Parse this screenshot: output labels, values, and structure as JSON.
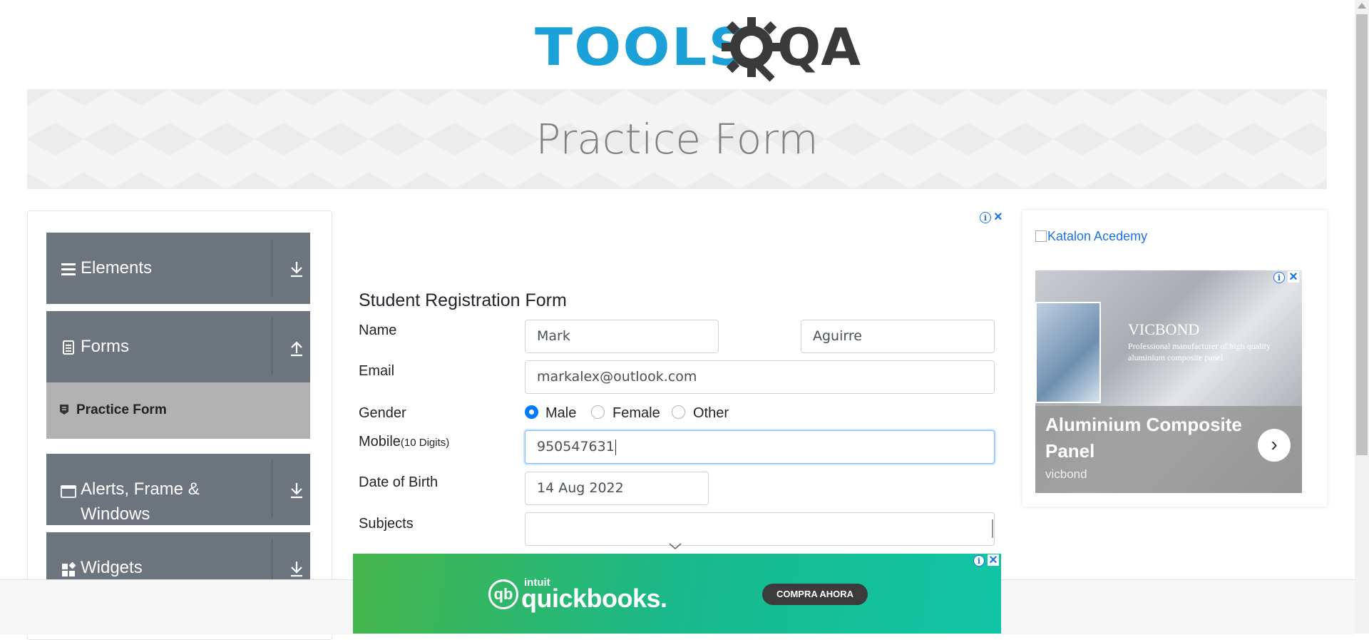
{
  "header": {
    "logo_text_left": "TOOLS",
    "logo_text_right": "QA"
  },
  "banner": {
    "title": "Practice Form"
  },
  "sidebar": {
    "groups": [
      {
        "label": "Elements",
        "icon": "hamburger-icon",
        "expanded": false
      },
      {
        "label": "Forms",
        "icon": "document-icon",
        "expanded": true
      },
      {
        "label": "Alerts, Frame & Windows",
        "icon": "window-icon",
        "expanded": false
      },
      {
        "label": "Widgets",
        "icon": "widgets-icon",
        "expanded": false
      }
    ],
    "active_item": {
      "label": "Practice Form",
      "icon": "form-icon"
    }
  },
  "form": {
    "title": "Student Registration Form",
    "name_label": "Name",
    "first_name": "Mark",
    "last_name": "Aguirre",
    "email_label": "Email",
    "email": "markalex@outlook.com",
    "gender_label": "Gender",
    "gender_options": [
      "Male",
      "Female",
      "Other"
    ],
    "gender_selected": "Male",
    "mobile_label": "Mobile",
    "mobile_hint": "(10 Digits)",
    "mobile": "950547631",
    "dob_label": "Date of Birth",
    "dob": "14 Aug 2022",
    "subjects_label": "Subjects",
    "subjects": ""
  },
  "ads": {
    "right": {
      "image_alt": "Katalon Acedemy",
      "brand": "VICBOND",
      "tagline": "Professional manufacturer of high quality aluminium composite panel",
      "title": "Aluminium Composite Panel",
      "subtitle": "vicbond"
    },
    "bottom": {
      "brand_small": "intuit",
      "brand": "quickbooks.",
      "cta": "COMPRA AHORA"
    }
  },
  "colors": {
    "sidebar_group_bg": "#6c757d",
    "sidebar_active_bg": "#b2b2b2",
    "radio_checked": "#007bff",
    "logo_blue": "#1ca0d8",
    "logo_dark": "#3a3a3a"
  }
}
